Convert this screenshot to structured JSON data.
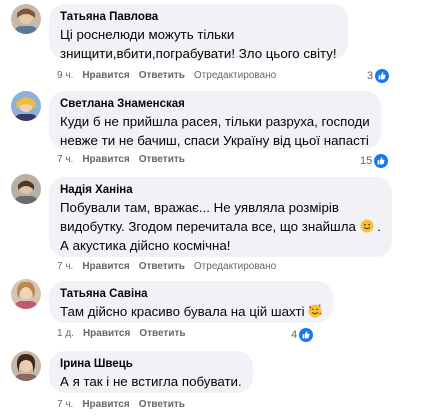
{
  "colors": {
    "bubble": "#f0f2f5",
    "meta_text": "#65676b",
    "like_blue": "#1877f2"
  },
  "comments": [
    {
      "author": "Татьяна Павлова",
      "lines": [
        "Ці роснелюди можуть тільки",
        "знищити,вбити,пограбувати! Зло цього світу!"
      ],
      "time": "9 ч.",
      "like_label": "Нравится",
      "reply_label": "Ответить",
      "edited": "Отредактировано",
      "reactions": "3"
    },
    {
      "author": "Светлана Знаменская",
      "lines": [
        "Куди б не прийшла расея, тільки разруха, господи",
        "невже ти не бачиш, спаси Україну від цьої напасті"
      ],
      "time": "7 ч.",
      "like_label": "Нравится",
      "reply_label": "Ответить",
      "edited": "",
      "reactions": "15"
    },
    {
      "author": "Надія Ханіна",
      "lines": [
        "Побували там, вражає... Не уявляла розмірів",
        "видобутку. Згодом перечитала все, що знайшла",
        "А акустика дійсно космічна!"
      ],
      "line2_suffix": ".",
      "emoji_smile": "slightly-smiling-face-emoji",
      "time": "7 ч.",
      "like_label": "Нравится",
      "reply_label": "Ответить",
      "edited": "Отредактировано",
      "reactions": ""
    },
    {
      "author": "Татьяна Савіна",
      "lines": [
        "Там дійсно красиво бувала на цій шахті"
      ],
      "emoji_love": "smiling-face-with-hearts-emoji",
      "time": "1 д.",
      "like_label": "Нравится",
      "reply_label": "Ответить",
      "edited": "",
      "reactions": "4"
    },
    {
      "author": "Ірина Швець",
      "lines": [
        "А я так і не встигла побувати."
      ],
      "time": "7 ч.",
      "like_label": "Нравится",
      "reply_label": "Ответить",
      "edited": "",
      "reactions": ""
    }
  ]
}
